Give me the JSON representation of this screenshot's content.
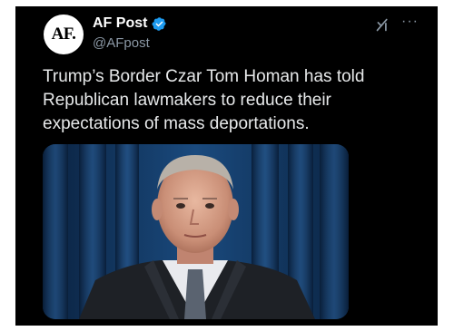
{
  "post": {
    "avatar_text": "AF.",
    "display_name": "AF Post",
    "handle": "@AFpost",
    "text": "Trump’s Border Czar Tom Homan has told Republican lawmakers to reduce their expectations of mass deportations.",
    "icons": {
      "verified": "verified-badge-icon",
      "grok": "grok-icon",
      "more": "more-options-icon"
    }
  },
  "colors": {
    "background": "#000000",
    "text": "#e7e9ea",
    "secondary_text": "#8b98a5",
    "verified_blue": "#1d9bf0"
  }
}
